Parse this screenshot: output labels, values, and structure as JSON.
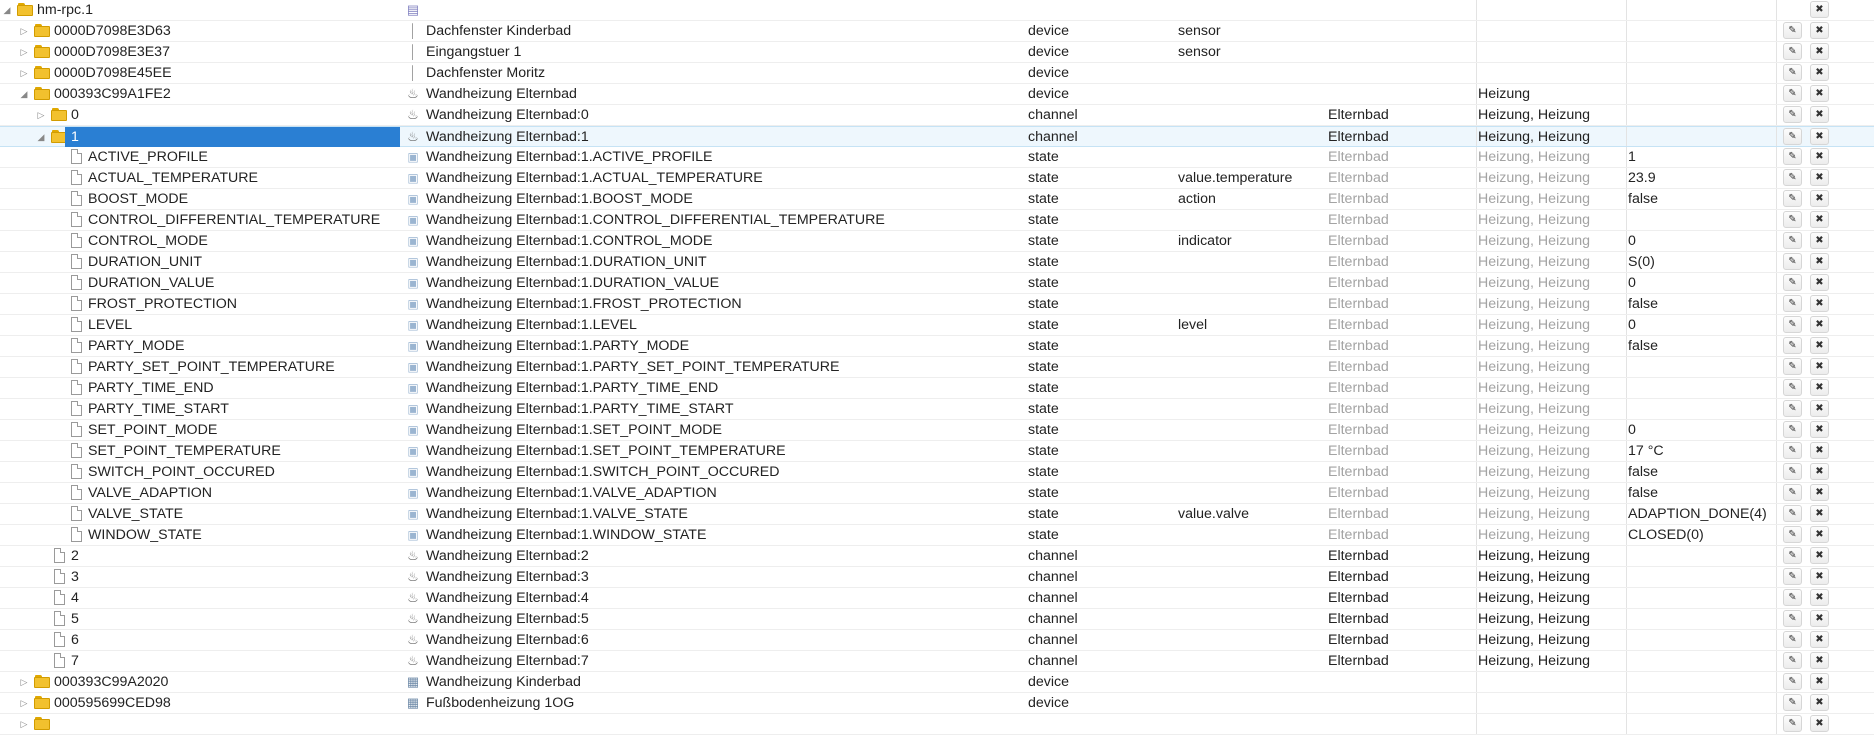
{
  "rows": [
    {
      "depth": 0,
      "toggle": "open",
      "ic": "folder",
      "name": "hm-rpc.1",
      "icon": "root-icon",
      "title": "",
      "type": "",
      "role": "",
      "room": "",
      "func": "",
      "value": "",
      "edit": false
    },
    {
      "depth": 1,
      "toggle": "closed",
      "ic": "folder",
      "name": "0000D7098E3D63",
      "icon": "sensor-icon",
      "title": "Dachfenster Kinderbad",
      "type": "device",
      "role": "sensor",
      "room": "",
      "func": "",
      "value": "",
      "edit": true
    },
    {
      "depth": 1,
      "toggle": "closed",
      "ic": "folder",
      "name": "0000D7098E3E37",
      "icon": "sensor-icon",
      "title": "Eingangstuer 1",
      "type": "device",
      "role": "sensor",
      "room": "",
      "func": "",
      "value": "",
      "edit": true
    },
    {
      "depth": 1,
      "toggle": "closed",
      "ic": "folder",
      "name": "0000D7098E45EE",
      "icon": "sensor-icon",
      "title": "Dachfenster Moritz",
      "type": "device",
      "role": "",
      "room": "",
      "func": "",
      "value": "",
      "edit": true
    },
    {
      "depth": 1,
      "toggle": "open",
      "ic": "folder",
      "name": "000393C99A1FE2",
      "icon": "heater-icon",
      "title": "Wandheizung Elternbad",
      "type": "device",
      "role": "",
      "room": "",
      "func": "Heizung",
      "value": "",
      "edit": true
    },
    {
      "depth": 2,
      "toggle": "closed",
      "ic": "folder",
      "name": "0",
      "icon": "heater-icon",
      "title": "Wandheizung Elternbad:0",
      "type": "channel",
      "role": "",
      "room": "Elternbad",
      "func": "Heizung, Heizung",
      "value": "",
      "edit": true
    },
    {
      "depth": 2,
      "toggle": "open",
      "ic": "folder",
      "name": "1",
      "icon": "heater-icon",
      "title": "Wandheizung Elternbad:1",
      "type": "channel",
      "role": "",
      "room": "Elternbad",
      "func": "Heizung, Heizung",
      "value": "",
      "edit": true,
      "selected": true
    },
    {
      "depth": 3,
      "ic": "file",
      "name": "ACTIVE_PROFILE",
      "icon": "state-icon",
      "title": "Wandheizung Elternbad:1.ACTIVE_PROFILE",
      "type": "state",
      "role": "",
      "room": "Elternbad",
      "func": "Heizung, Heizung",
      "value": "1",
      "edit": true,
      "grey": true
    },
    {
      "depth": 3,
      "ic": "file",
      "name": "ACTUAL_TEMPERATURE",
      "icon": "state-icon",
      "title": "Wandheizung Elternbad:1.ACTUAL_TEMPERATURE",
      "type": "state",
      "role": "value.temperature",
      "room": "Elternbad",
      "func": "Heizung, Heizung",
      "value": "23.9",
      "edit": true,
      "grey": true
    },
    {
      "depth": 3,
      "ic": "file",
      "name": "BOOST_MODE",
      "icon": "state-icon",
      "title": "Wandheizung Elternbad:1.BOOST_MODE",
      "type": "state",
      "role": "action",
      "room": "Elternbad",
      "func": "Heizung, Heizung",
      "value": "false",
      "edit": true,
      "grey": true
    },
    {
      "depth": 3,
      "ic": "file",
      "name": "CONTROL_DIFFERENTIAL_TEMPERATURE",
      "icon": "state-icon",
      "title": "Wandheizung Elternbad:1.CONTROL_DIFFERENTIAL_TEMPERATURE",
      "type": "state",
      "role": "",
      "room": "Elternbad",
      "func": "Heizung, Heizung",
      "value": "",
      "edit": true,
      "grey": true
    },
    {
      "depth": 3,
      "ic": "file",
      "name": "CONTROL_MODE",
      "icon": "state-icon",
      "title": "Wandheizung Elternbad:1.CONTROL_MODE",
      "type": "state",
      "role": "indicator",
      "room": "Elternbad",
      "func": "Heizung, Heizung",
      "value": "0",
      "edit": true,
      "grey": true
    },
    {
      "depth": 3,
      "ic": "file",
      "name": "DURATION_UNIT",
      "icon": "state-icon",
      "title": "Wandheizung Elternbad:1.DURATION_UNIT",
      "type": "state",
      "role": "",
      "room": "Elternbad",
      "func": "Heizung, Heizung",
      "value": "S(0)",
      "edit": true,
      "grey": true
    },
    {
      "depth": 3,
      "ic": "file",
      "name": "DURATION_VALUE",
      "icon": "state-icon",
      "title": "Wandheizung Elternbad:1.DURATION_VALUE",
      "type": "state",
      "role": "",
      "room": "Elternbad",
      "func": "Heizung, Heizung",
      "value": "0",
      "edit": true,
      "grey": true
    },
    {
      "depth": 3,
      "ic": "file",
      "name": "FROST_PROTECTION",
      "icon": "state-icon",
      "title": "Wandheizung Elternbad:1.FROST_PROTECTION",
      "type": "state",
      "role": "",
      "room": "Elternbad",
      "func": "Heizung, Heizung",
      "value": "false",
      "edit": true,
      "grey": true
    },
    {
      "depth": 3,
      "ic": "file",
      "name": "LEVEL",
      "icon": "state-icon",
      "title": "Wandheizung Elternbad:1.LEVEL",
      "type": "state",
      "role": "level",
      "room": "Elternbad",
      "func": "Heizung, Heizung",
      "value": "0",
      "edit": true,
      "grey": true
    },
    {
      "depth": 3,
      "ic": "file",
      "name": "PARTY_MODE",
      "icon": "state-icon",
      "title": "Wandheizung Elternbad:1.PARTY_MODE",
      "type": "state",
      "role": "",
      "room": "Elternbad",
      "func": "Heizung, Heizung",
      "value": "false",
      "edit": true,
      "grey": true
    },
    {
      "depth": 3,
      "ic": "file",
      "name": "PARTY_SET_POINT_TEMPERATURE",
      "icon": "state-icon",
      "title": "Wandheizung Elternbad:1.PARTY_SET_POINT_TEMPERATURE",
      "type": "state",
      "role": "",
      "room": "Elternbad",
      "func": "Heizung, Heizung",
      "value": "",
      "edit": true,
      "grey": true
    },
    {
      "depth": 3,
      "ic": "file",
      "name": "PARTY_TIME_END",
      "icon": "state-icon",
      "title": "Wandheizung Elternbad:1.PARTY_TIME_END",
      "type": "state",
      "role": "",
      "room": "Elternbad",
      "func": "Heizung, Heizung",
      "value": "",
      "edit": true,
      "grey": true
    },
    {
      "depth": 3,
      "ic": "file",
      "name": "PARTY_TIME_START",
      "icon": "state-icon",
      "title": "Wandheizung Elternbad:1.PARTY_TIME_START",
      "type": "state",
      "role": "",
      "room": "Elternbad",
      "func": "Heizung, Heizung",
      "value": "",
      "edit": true,
      "grey": true
    },
    {
      "depth": 3,
      "ic": "file",
      "name": "SET_POINT_MODE",
      "icon": "state-icon",
      "title": "Wandheizung Elternbad:1.SET_POINT_MODE",
      "type": "state",
      "role": "",
      "room": "Elternbad",
      "func": "Heizung, Heizung",
      "value": "0",
      "edit": true,
      "grey": true
    },
    {
      "depth": 3,
      "ic": "file",
      "name": "SET_POINT_TEMPERATURE",
      "icon": "state-icon",
      "title": "Wandheizung Elternbad:1.SET_POINT_TEMPERATURE",
      "type": "state",
      "role": "",
      "room": "Elternbad",
      "func": "Heizung, Heizung",
      "value": "17 °C",
      "edit": true,
      "grey": true
    },
    {
      "depth": 3,
      "ic": "file",
      "name": "SWITCH_POINT_OCCURED",
      "icon": "state-icon",
      "title": "Wandheizung Elternbad:1.SWITCH_POINT_OCCURED",
      "type": "state",
      "role": "",
      "room": "Elternbad",
      "func": "Heizung, Heizung",
      "value": "false",
      "edit": true,
      "grey": true
    },
    {
      "depth": 3,
      "ic": "file",
      "name": "VALVE_ADAPTION",
      "icon": "state-icon",
      "title": "Wandheizung Elternbad:1.VALVE_ADAPTION",
      "type": "state",
      "role": "",
      "room": "Elternbad",
      "func": "Heizung, Heizung",
      "value": "false",
      "edit": true,
      "grey": true
    },
    {
      "depth": 3,
      "ic": "file",
      "name": "VALVE_STATE",
      "icon": "state-icon",
      "title": "Wandheizung Elternbad:1.VALVE_STATE",
      "type": "state",
      "role": "value.valve",
      "room": "Elternbad",
      "func": "Heizung, Heizung",
      "value": "ADAPTION_DONE(4)",
      "edit": true,
      "grey": true
    },
    {
      "depth": 3,
      "ic": "file",
      "name": "WINDOW_STATE",
      "icon": "state-icon",
      "title": "Wandheizung Elternbad:1.WINDOW_STATE",
      "type": "state",
      "role": "",
      "room": "Elternbad",
      "func": "Heizung, Heizung",
      "value": "CLOSED(0)",
      "edit": true,
      "grey": true
    },
    {
      "depth": 2,
      "ic": "file",
      "name": "2",
      "icon": "heater-icon",
      "title": "Wandheizung Elternbad:2",
      "type": "channel",
      "role": "",
      "room": "Elternbad",
      "func": "Heizung, Heizung",
      "value": "",
      "edit": true
    },
    {
      "depth": 2,
      "ic": "file",
      "name": "3",
      "icon": "heater-icon",
      "title": "Wandheizung Elternbad:3",
      "type": "channel",
      "role": "",
      "room": "Elternbad",
      "func": "Heizung, Heizung",
      "value": "",
      "edit": true
    },
    {
      "depth": 2,
      "ic": "file",
      "name": "4",
      "icon": "heater-icon",
      "title": "Wandheizung Elternbad:4",
      "type": "channel",
      "role": "",
      "room": "Elternbad",
      "func": "Heizung, Heizung",
      "value": "",
      "edit": true
    },
    {
      "depth": 2,
      "ic": "file",
      "name": "5",
      "icon": "heater-icon",
      "title": "Wandheizung Elternbad:5",
      "type": "channel",
      "role": "",
      "room": "Elternbad",
      "func": "Heizung, Heizung",
      "value": "",
      "edit": true
    },
    {
      "depth": 2,
      "ic": "file",
      "name": "6",
      "icon": "heater-icon",
      "title": "Wandheizung Elternbad:6",
      "type": "channel",
      "role": "",
      "room": "Elternbad",
      "func": "Heizung, Heizung",
      "value": "",
      "edit": true
    },
    {
      "depth": 2,
      "ic": "file",
      "name": "7",
      "icon": "heater-icon",
      "title": "Wandheizung Elternbad:7",
      "type": "channel",
      "role": "",
      "room": "Elternbad",
      "func": "Heizung, Heizung",
      "value": "",
      "edit": true
    },
    {
      "depth": 1,
      "toggle": "closed",
      "ic": "folder",
      "name": "000393C99A2020",
      "icon": "device-icon",
      "title": "Wandheizung Kinderbad",
      "type": "device",
      "role": "",
      "room": "",
      "func": "",
      "value": "",
      "edit": true
    },
    {
      "depth": 1,
      "toggle": "closed",
      "ic": "folder",
      "name": "000595699CED98",
      "icon": "device-icon",
      "title": "Fußbodenheizung 1OG",
      "type": "device",
      "role": "",
      "room": "",
      "func": "",
      "value": "",
      "edit": true
    },
    {
      "depth": 1,
      "toggle": "closed",
      "ic": "folder",
      "name": "",
      "icon": "",
      "title": "",
      "type": "",
      "role": "",
      "room": "",
      "func": "",
      "value": "",
      "edit": true
    }
  ]
}
